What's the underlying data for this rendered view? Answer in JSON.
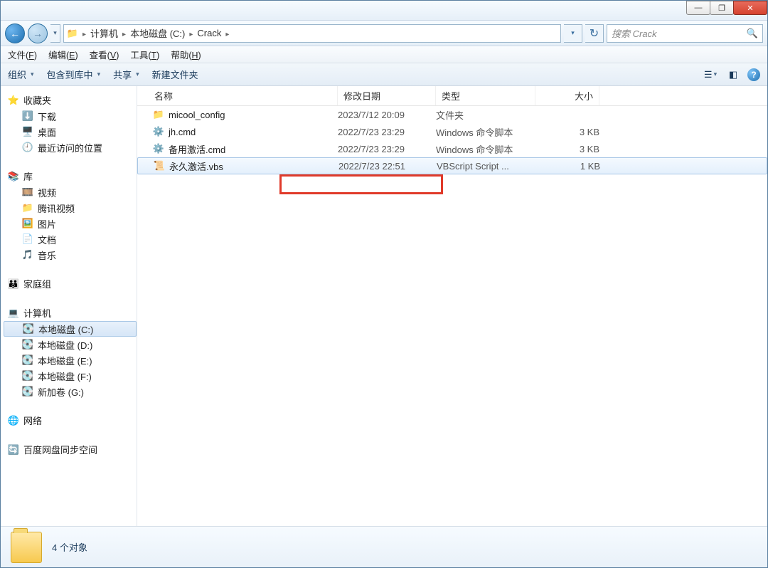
{
  "window_controls": {
    "min": "—",
    "max": "❐",
    "close": "✕"
  },
  "breadcrumb": [
    "计算机",
    "本地磁盘 (C:)",
    "Crack"
  ],
  "search_placeholder": "搜索 Crack",
  "menubar": [
    {
      "label": "文件(",
      "key": "F",
      "tail": ")"
    },
    {
      "label": "编辑(",
      "key": "E",
      "tail": ")"
    },
    {
      "label": "查看(",
      "key": "V",
      "tail": ")"
    },
    {
      "label": "工具(",
      "key": "T",
      "tail": ")"
    },
    {
      "label": "帮助(",
      "key": "H",
      "tail": ")"
    }
  ],
  "toolbar": {
    "organize": "组织",
    "include": "包含到库中",
    "share": "共享",
    "newfolder": "新建文件夹"
  },
  "sidebar": {
    "favorites": {
      "head": "收藏夹",
      "items": [
        "下载",
        "桌面",
        "最近访问的位置"
      ]
    },
    "library": {
      "head": "库",
      "items": [
        "视频",
        "腾讯视频",
        "图片",
        "文档",
        "音乐"
      ]
    },
    "homegroup": "家庭组",
    "computer": {
      "head": "计算机",
      "items": [
        "本地磁盘 (C:)",
        "本地磁盘 (D:)",
        "本地磁盘 (E:)",
        "本地磁盘 (F:)",
        "新加卷 (G:)"
      ]
    },
    "network": "网络",
    "baidu": "百度网盘同步空间"
  },
  "columns": {
    "name": "名称",
    "date": "修改日期",
    "type": "类型",
    "size": "大小"
  },
  "files": [
    {
      "icon": "folder",
      "name": "micool_config",
      "date": "2023/7/12 20:09",
      "type": "文件夹",
      "size": ""
    },
    {
      "icon": "cmd",
      "name": "jh.cmd",
      "date": "2022/7/23 23:29",
      "type": "Windows 命令脚本",
      "size": "3 KB"
    },
    {
      "icon": "cmd",
      "name": "备用激活.cmd",
      "date": "2022/7/23 23:29",
      "type": "Windows 命令脚本",
      "size": "3 KB"
    },
    {
      "icon": "vbs",
      "name": "永久激活.vbs",
      "date": "2022/7/23 22:51",
      "type": "VBScript Script ...",
      "size": "1 KB"
    }
  ],
  "selected_index": 3,
  "status": "4 个对象"
}
